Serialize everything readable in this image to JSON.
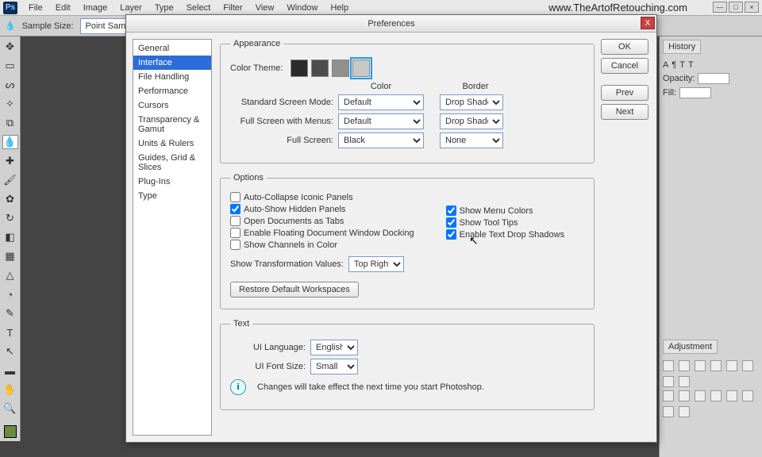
{
  "menubar": {
    "items": [
      "File",
      "Edit",
      "Image",
      "Layer",
      "Type",
      "Select",
      "Filter",
      "View",
      "Window",
      "Help"
    ]
  },
  "url": "www.TheArtofRetouching.com",
  "optbar": {
    "sample_label": "Sample Size:",
    "sample_value": "Point Sample"
  },
  "dialog": {
    "title": "Preferences",
    "categories": [
      "General",
      "Interface",
      "File Handling",
      "Performance",
      "Cursors",
      "Transparency & Gamut",
      "Units & Rulers",
      "Guides, Grid & Slices",
      "Plug-Ins",
      "Type"
    ],
    "selected_category": 1,
    "buttons": {
      "ok": "OK",
      "cancel": "Cancel",
      "prev": "Prev",
      "next": "Next"
    },
    "appearance": {
      "legend": "Appearance",
      "color_theme_label": "Color Theme:",
      "swatches": [
        "#2b2b2b",
        "#4d4d4d",
        "#909090",
        "#c8c8c8"
      ],
      "selected_swatch": 3,
      "col_color": "Color",
      "col_border": "Border",
      "rows": [
        {
          "label": "Standard Screen Mode:",
          "color": "Default",
          "border": "Drop Shadow"
        },
        {
          "label": "Full Screen with Menus:",
          "color": "Default",
          "border": "Drop Shadow"
        },
        {
          "label": "Full Screen:",
          "color": "Black",
          "border": "None"
        }
      ]
    },
    "options": {
      "legend": "Options",
      "left": [
        {
          "label": "Auto-Collapse Iconic Panels",
          "checked": false
        },
        {
          "label": "Auto-Show Hidden Panels",
          "checked": true
        },
        {
          "label": "Open Documents as Tabs",
          "checked": false
        },
        {
          "label": "Enable Floating Document Window Docking",
          "checked": false
        },
        {
          "label": "Show Channels in Color",
          "checked": false
        }
      ],
      "right": [
        {
          "label": "Show Menu Colors",
          "checked": true
        },
        {
          "label": "Show Tool Tips",
          "checked": true
        },
        {
          "label": "Enable Text Drop Shadows",
          "checked": true
        }
      ],
      "transform_label": "Show Transformation Values:",
      "transform_value": "Top Right",
      "restore": "Restore Default Workspaces"
    },
    "text": {
      "legend": "Text",
      "lang_label": "UI Language:",
      "lang_value": "English",
      "font_label": "UI Font Size:",
      "font_value": "Small",
      "note": "Changes will take effect the next time you start Photoshop."
    }
  },
  "rpanel": {
    "history": "History",
    "adjustment": "Adjustment",
    "opacity": "Opacity:",
    "fill": "Fill:"
  }
}
